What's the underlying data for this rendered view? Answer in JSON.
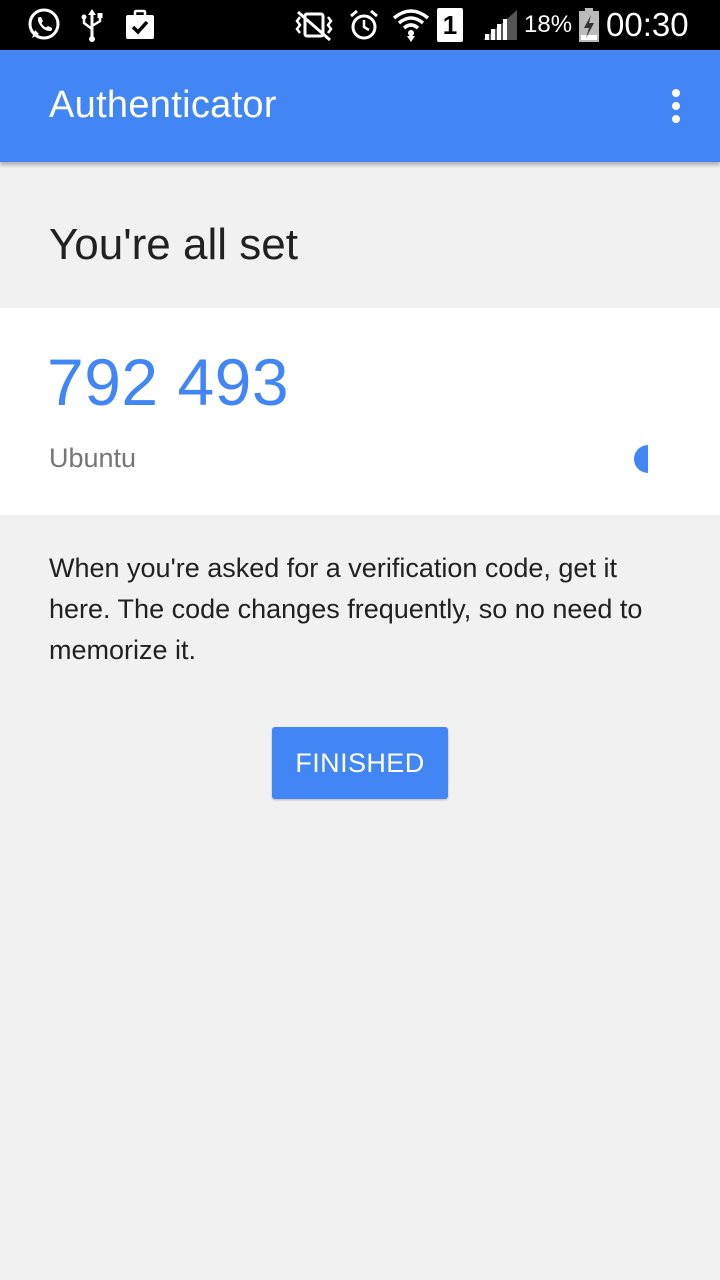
{
  "status_bar": {
    "battery_percent": "18%",
    "time": "00:30",
    "sim_slot": "1",
    "icons": [
      "whatsapp-icon",
      "usb-icon",
      "task-check-icon",
      "vibrate-icon",
      "alarm-icon",
      "wifi-icon",
      "sim-icon",
      "signal-icon",
      "battery-charging-icon"
    ]
  },
  "app_bar": {
    "title": "Authenticator",
    "menu_icon": "more-vert-icon"
  },
  "main": {
    "heading": "You're all set",
    "code": "792 493",
    "account": "Ubuntu",
    "description": "When you're asked for a verification code, get it here. The code changes frequently, so no need to memorize it.",
    "finished_label": "FINISHED"
  },
  "colors": {
    "accent": "#4285f4",
    "background": "#f1f1f1",
    "card": "#ffffff",
    "text_primary": "#212121",
    "text_secondary": "#757575"
  }
}
